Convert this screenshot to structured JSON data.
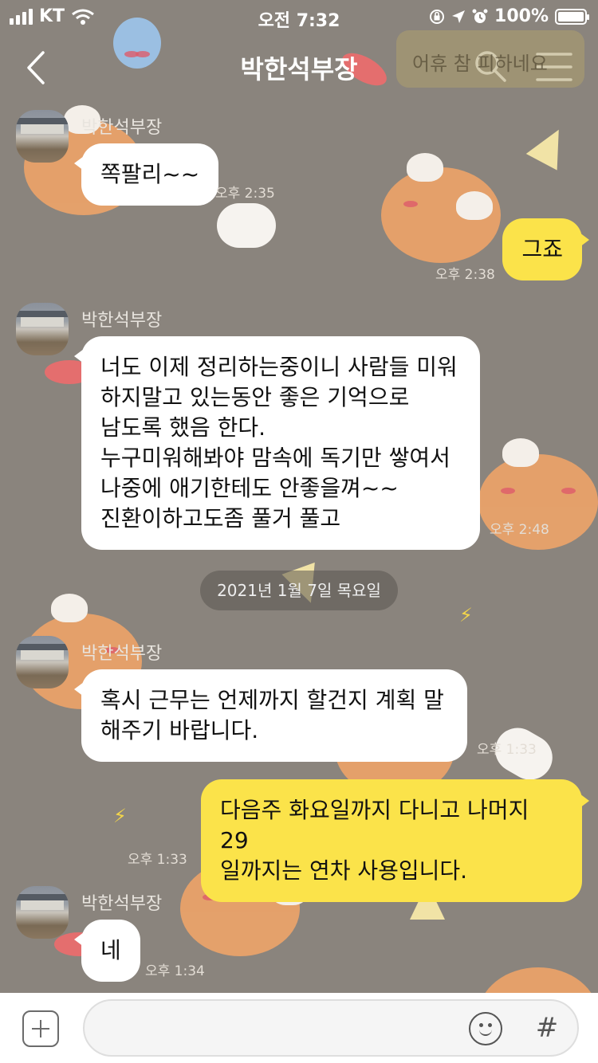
{
  "status_bar": {
    "carrier": "KT",
    "time": "오전 7:32",
    "battery": "100%",
    "battery_level": 1.0
  },
  "header": {
    "title": "박한석부장",
    "toast": "어휴 참 피하네요"
  },
  "date_divider": "2021년 1월 7일 목요일",
  "messages": [
    {
      "sender": "박한석부장",
      "text": "쪽팔리~~",
      "time": "오후 2:35"
    },
    {
      "text": "그죠",
      "time": "오후 2:38"
    },
    {
      "sender": "박한석부장",
      "lines": [
        "너도 이제 정리하는중이니 사람들 미워",
        "하지말고 있는동안 좋은 기억으로",
        "남도록 했음 한다.",
        "누구미워해봐야 맘속에 독기만 쌓여서",
        "나중에 애기한테도 안좋을껴~~",
        "진환이하고도좀 풀거 풀고"
      ],
      "time": "오후 2:48"
    },
    {
      "sender": "박한석부장",
      "lines": [
        "혹시 근무는 언제까지 할건지 계획 말",
        "해주기 바랍니다."
      ],
      "time": "오후 1:33"
    },
    {
      "lines": [
        "다음주 화요일까지 다니고 나머지 29",
        "일까지는 연차 사용입니다."
      ],
      "time": "오후 1:33"
    },
    {
      "sender": "박한석부장",
      "text": "네",
      "time": "오후 1:34"
    }
  ],
  "input": {
    "placeholder": ""
  },
  "icons": {
    "back": "chevron-left-icon",
    "search": "search-icon",
    "menu": "menu-icon",
    "plus": "plus-icon",
    "emoji": "emoji-icon",
    "hash": "hash-icon"
  },
  "colors": {
    "background": "#8a847d",
    "my_bubble": "#fbe34a",
    "other_bubble": "#ffffff"
  }
}
